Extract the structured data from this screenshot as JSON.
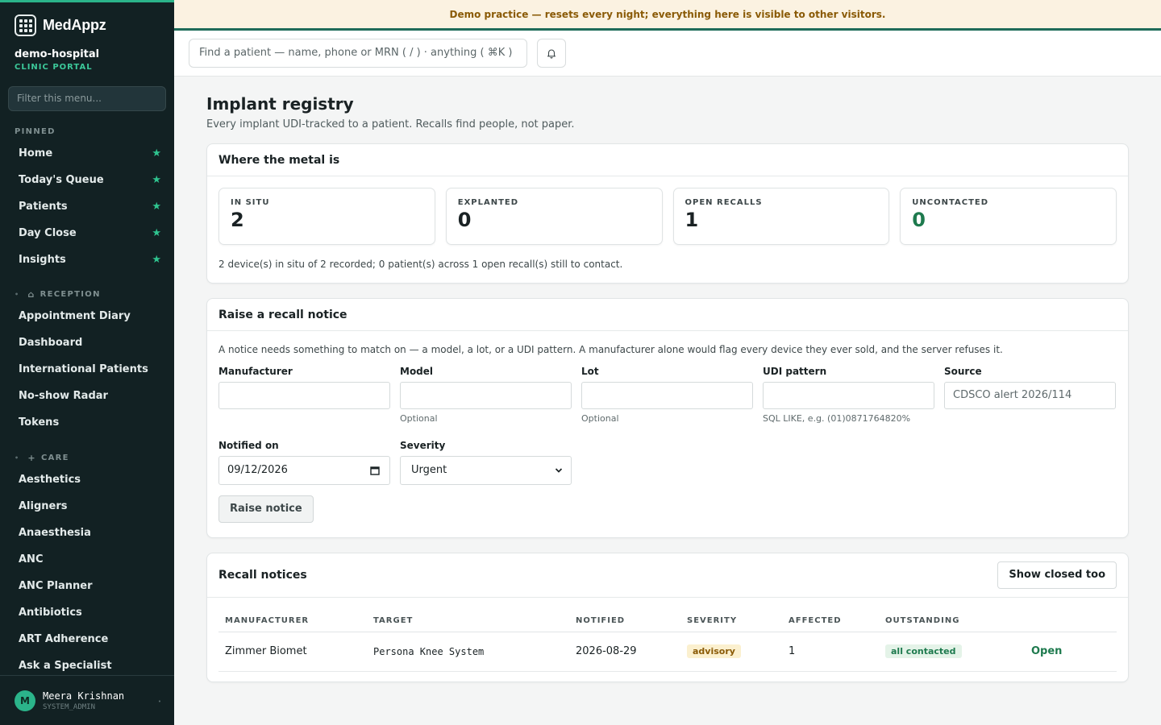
{
  "brand": {
    "name": "MedAppz",
    "org": "demo-hospital",
    "portal": "CLINIC PORTAL"
  },
  "sidebar": {
    "filter_placeholder": "Filter this menu...",
    "pinned_label": "PINNED",
    "pinned": [
      {
        "label": "Home"
      },
      {
        "label": "Today's Queue"
      },
      {
        "label": "Patients"
      },
      {
        "label": "Day Close"
      },
      {
        "label": "Insights"
      }
    ],
    "reception_label": "RECEPTION",
    "reception": [
      {
        "label": "Appointment Diary"
      },
      {
        "label": "Dashboard"
      },
      {
        "label": "International Patients"
      },
      {
        "label": "No-show Radar"
      },
      {
        "label": "Tokens"
      }
    ],
    "care_label": "CARE",
    "care": [
      {
        "label": "Aesthetics"
      },
      {
        "label": "Aligners"
      },
      {
        "label": "Anaesthesia"
      },
      {
        "label": "ANC"
      },
      {
        "label": "ANC Planner"
      },
      {
        "label": "Antibiotics"
      },
      {
        "label": "ART Adherence"
      },
      {
        "label": "Ask a Specialist"
      }
    ],
    "user": {
      "initial": "M",
      "name": "Meera Krishnan",
      "role": "SYSTEM_ADMIN"
    }
  },
  "banner": {
    "text": "Demo practice — resets every night; everything here is visible to other visitors."
  },
  "topbar": {
    "search_placeholder": "Find a patient — name, phone or MRN ( / ) · anything ( ⌘K )"
  },
  "page": {
    "title": "Implant registry",
    "subtitle": "Every implant UDI-tracked to a patient. Recalls find people, not paper."
  },
  "metal": {
    "heading": "Where the metal is",
    "stats": [
      {
        "label": "IN SITU",
        "value": "2"
      },
      {
        "label": "EXPLANTED",
        "value": "0"
      },
      {
        "label": "OPEN RECALLS",
        "value": "1"
      },
      {
        "label": "UNCONTACTED",
        "value": "0"
      }
    ],
    "summary": "2 device(s) in situ of 2 recorded; 0 patient(s) across 1 open recall(s) still to contact."
  },
  "recall_form": {
    "heading": "Raise a recall notice",
    "note": "A notice needs something to match on — a model, a lot, or a UDI pattern. A manufacturer alone would flag every device they ever sold, and the server refuses it.",
    "manufacturer": {
      "label": "Manufacturer",
      "value": ""
    },
    "model": {
      "label": "Model",
      "value": "",
      "hint": "Optional"
    },
    "lot": {
      "label": "Lot",
      "value": "",
      "hint": "Optional"
    },
    "udi": {
      "label": "UDI pattern",
      "value": "",
      "hint": "SQL LIKE, e.g. (01)0871764820%"
    },
    "source": {
      "label": "Source",
      "placeholder": "CDSCO alert 2026/114"
    },
    "notified_on": {
      "label": "Notified on",
      "value": "09/12/2026"
    },
    "severity": {
      "label": "Severity",
      "value": "Urgent"
    },
    "submit_label": "Raise notice"
  },
  "notices": {
    "heading": "Recall notices",
    "toggle_label": "Show closed too",
    "columns": [
      "MANUFACTURER",
      "TARGET",
      "NOTIFIED",
      "SEVERITY",
      "AFFECTED",
      "OUTSTANDING"
    ],
    "rows": [
      {
        "manufacturer": "Zimmer Biomet",
        "target": "Persona Knee System",
        "notified": "2026-08-29",
        "severity": "advisory",
        "affected": "1",
        "outstanding": "all contacted",
        "action": "Open"
      }
    ]
  },
  "colors": {
    "accent": "#2bb48a",
    "sidebar_bg": "#122123",
    "banner_bg": "#fbf2e1",
    "success": "#1e7a4e",
    "warning": "#8a5a06"
  }
}
